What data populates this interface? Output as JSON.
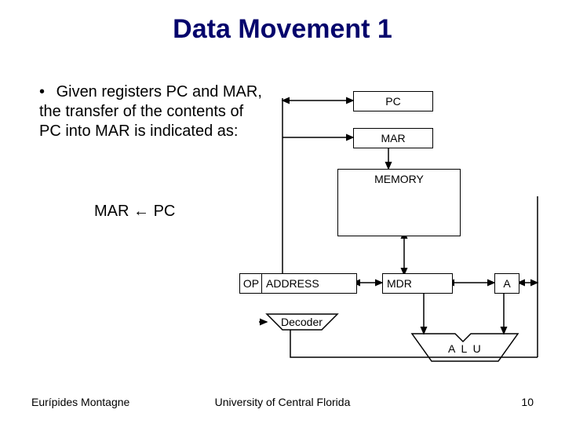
{
  "title": "Data Movement 1",
  "bullet_text": "Given registers PC and MAR, the transfer of the contents of PC into MAR is indicated as:",
  "rtl_left": "MAR",
  "rtl_arrow": "←",
  "rtl_right": "PC",
  "boxes": {
    "pc": "PC",
    "mar": "MAR",
    "memory": "MEMORY",
    "op": "OP",
    "address": "ADDRESS",
    "mdr": "MDR",
    "a": "A",
    "decoder": "Decoder",
    "alu": "A L U"
  },
  "footer": {
    "left": "Eurípides Montagne",
    "center": "University of Central Florida",
    "right": "10"
  }
}
